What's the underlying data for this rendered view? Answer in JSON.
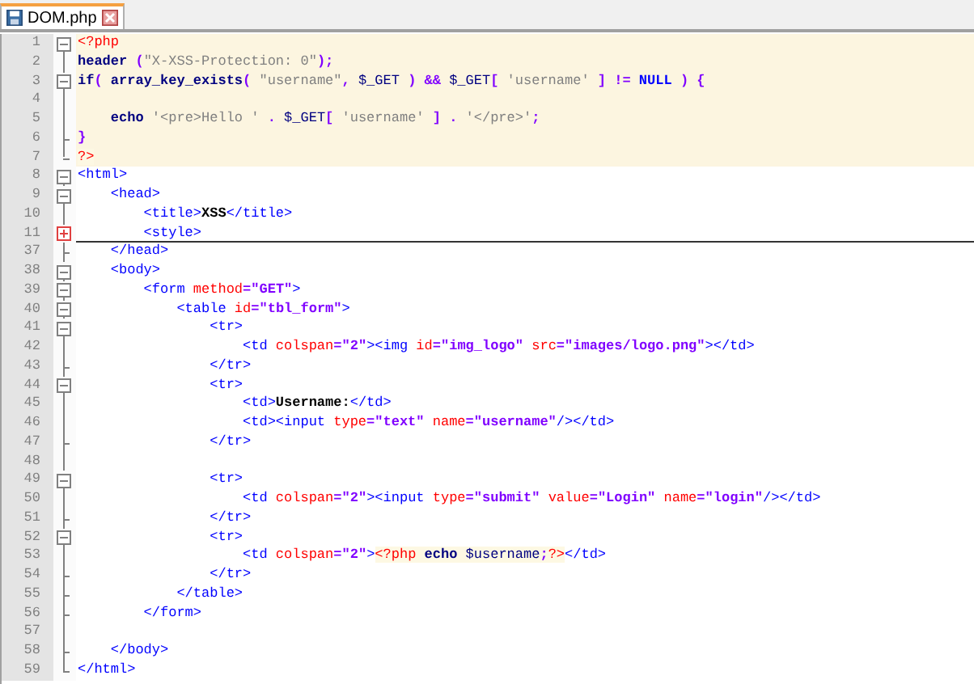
{
  "tabs": [
    {
      "label": "DOM.php",
      "selected": true
    }
  ],
  "lines": [
    {
      "number": "1",
      "kind": "fold-start",
      "php_block": true,
      "tokens": [
        {
          "kind": "php-tag",
          "text": "<?php"
        }
      ]
    },
    {
      "number": "2",
      "kind": "body",
      "php_block": true,
      "tokens": [
        {
          "kind": "fn",
          "text": "header"
        },
        {
          "kind": "op",
          "text": " ("
        },
        {
          "kind": "str",
          "text": "\"X-XSS-Protection: 0\""
        },
        {
          "kind": "op",
          "text": ");"
        }
      ]
    },
    {
      "number": "3",
      "kind": "fold-start",
      "php_block": true,
      "tokens": [
        {
          "kind": "fn",
          "text": "if"
        },
        {
          "kind": "op",
          "text": "("
        },
        {
          "kind": "fn",
          "text": " array_key_exists"
        },
        {
          "kind": "op",
          "text": "("
        },
        {
          "kind": "str",
          "text": " \"username\""
        },
        {
          "kind": "op",
          "text": ","
        },
        {
          "kind": "var",
          "text": " $_GET"
        },
        {
          "kind": "op",
          "text": " ) &&"
        },
        {
          "kind": "var",
          "text": " $_GET"
        },
        {
          "kind": "op",
          "text": "["
        },
        {
          "kind": "str",
          "text": " 'username'"
        },
        {
          "kind": "op",
          "text": " ] !="
        },
        {
          "kind": "const",
          "text": " NULL"
        },
        {
          "kind": "op",
          "text": " ) {"
        }
      ]
    },
    {
      "number": "4",
      "kind": "body",
      "php_block": true
    },
    {
      "number": "5",
      "kind": "body",
      "php_block": true,
      "tokens": [
        {
          "kind": "fn",
          "text": "    echo"
        },
        {
          "kind": "str",
          "text": " '<pre>Hello '"
        },
        {
          "kind": "op",
          "text": " ."
        },
        {
          "kind": "var",
          "text": " $_GET"
        },
        {
          "kind": "op",
          "text": "["
        },
        {
          "kind": "str",
          "text": " 'username'"
        },
        {
          "kind": "op",
          "text": " ] ."
        },
        {
          "kind": "str",
          "text": " '</pre>'"
        },
        {
          "kind": "op",
          "text": ";"
        }
      ]
    },
    {
      "number": "6",
      "kind": "fold-close",
      "php_block": true,
      "tokens": [
        {
          "kind": "op",
          "text": "}"
        }
      ]
    },
    {
      "number": "7",
      "kind": "fold-last",
      "php_block": true,
      "tokens": [
        {
          "kind": "php-tag",
          "text": "?>"
        }
      ]
    },
    {
      "number": "8",
      "kind": "fold-start",
      "php_block": false,
      "tokens": [
        {
          "kind": "tag",
          "text": "<html>"
        }
      ]
    },
    {
      "number": "9",
      "kind": "fold-start",
      "php_block": false,
      "tokens": [
        {
          "kind": "tag",
          "text": "    <head>"
        }
      ]
    },
    {
      "number": "10",
      "kind": "body",
      "php_block": false,
      "tokens": [
        {
          "kind": "tag",
          "text": "        <title>"
        },
        {
          "kind": "text",
          "text": "XSS"
        },
        {
          "kind": "tag",
          "text": "</title>"
        }
      ]
    },
    {
      "number": "11",
      "kind": "folded",
      "php_block": false,
      "tokens": [
        {
          "kind": "tag",
          "text": "        <style>"
        }
      ]
    },
    {
      "number": "37",
      "kind": "fold-close",
      "php_block": false,
      "tokens": [
        {
          "kind": "tag",
          "text": "    </head>"
        }
      ]
    },
    {
      "number": "38",
      "kind": "fold-start",
      "php_block": false,
      "tokens": [
        {
          "kind": "tag",
          "text": "    <body>"
        }
      ]
    },
    {
      "number": "39",
      "kind": "fold-start",
      "php_block": false,
      "tokens": [
        {
          "kind": "tag",
          "text": "        <form"
        },
        {
          "kind": "attr",
          "text": " method"
        },
        {
          "kind": "op",
          "text": "="
        },
        {
          "kind": "value",
          "text": "\"GET\""
        },
        {
          "kind": "tag",
          "text": ">"
        }
      ]
    },
    {
      "number": "40",
      "kind": "fold-start",
      "php_block": false,
      "tokens": [
        {
          "kind": "tag",
          "text": "            <table"
        },
        {
          "kind": "attr",
          "text": " id"
        },
        {
          "kind": "op",
          "text": "="
        },
        {
          "kind": "value",
          "text": "\"tbl_form\""
        },
        {
          "kind": "tag",
          "text": ">"
        }
      ]
    },
    {
      "number": "41",
      "kind": "fold-start",
      "php_block": false,
      "tokens": [
        {
          "kind": "tag",
          "text": "                <tr>"
        }
      ]
    },
    {
      "number": "42",
      "kind": "body",
      "php_block": false,
      "tokens": [
        {
          "kind": "tag",
          "text": "                    <td"
        },
        {
          "kind": "attr",
          "text": " colspan"
        },
        {
          "kind": "op",
          "text": "="
        },
        {
          "kind": "value",
          "text": "\"2\""
        },
        {
          "kind": "tag",
          "text": "><img"
        },
        {
          "kind": "attr",
          "text": " id"
        },
        {
          "kind": "op",
          "text": "="
        },
        {
          "kind": "value",
          "text": "\"img_logo\""
        },
        {
          "kind": "attr",
          "text": " src"
        },
        {
          "kind": "op",
          "text": "="
        },
        {
          "kind": "value",
          "text": "\"images/logo.png\""
        },
        {
          "kind": "tag",
          "text": "></td>"
        }
      ]
    },
    {
      "number": "43",
      "kind": "fold-close",
      "php_block": false,
      "tokens": [
        {
          "kind": "tag",
          "text": "                </tr>"
        }
      ]
    },
    {
      "number": "44",
      "kind": "fold-start",
      "php_block": false,
      "tokens": [
        {
          "kind": "tag",
          "text": "                <tr>"
        }
      ]
    },
    {
      "number": "45",
      "kind": "body",
      "php_block": false,
      "tokens": [
        {
          "kind": "tag",
          "text": "                    <td>"
        },
        {
          "kind": "text",
          "text": "Username:"
        },
        {
          "kind": "tag",
          "text": "</td>"
        }
      ]
    },
    {
      "number": "46",
      "kind": "body",
      "php_block": false,
      "tokens": [
        {
          "kind": "tag",
          "text": "                    <td><input"
        },
        {
          "kind": "attr",
          "text": " type"
        },
        {
          "kind": "op",
          "text": "="
        },
        {
          "kind": "value",
          "text": "\"text\""
        },
        {
          "kind": "attr",
          "text": " name"
        },
        {
          "kind": "op",
          "text": "="
        },
        {
          "kind": "value",
          "text": "\"username\""
        },
        {
          "kind": "tag",
          "text": "/></td>"
        }
      ]
    },
    {
      "number": "47",
      "kind": "fold-close",
      "php_block": false,
      "tokens": [
        {
          "kind": "tag",
          "text": "                </tr>"
        }
      ]
    },
    {
      "number": "48",
      "kind": "body",
      "php_block": false
    },
    {
      "number": "49",
      "kind": "fold-start",
      "php_block": false,
      "tokens": [
        {
          "kind": "tag",
          "text": "                <tr>"
        }
      ]
    },
    {
      "number": "50",
      "kind": "body",
      "php_block": false,
      "tokens": [
        {
          "kind": "tag",
          "text": "                    <td"
        },
        {
          "kind": "attr",
          "text": " colspan"
        },
        {
          "kind": "op",
          "text": "="
        },
        {
          "kind": "value",
          "text": "\"2\""
        },
        {
          "kind": "tag",
          "text": "><input"
        },
        {
          "kind": "attr",
          "text": " type"
        },
        {
          "kind": "op",
          "text": "="
        },
        {
          "kind": "value",
          "text": "\"submit\""
        },
        {
          "kind": "attr",
          "text": " value"
        },
        {
          "kind": "op",
          "text": "="
        },
        {
          "kind": "value",
          "text": "\"Login\""
        },
        {
          "kind": "attr",
          "text": " name"
        },
        {
          "kind": "op",
          "text": "="
        },
        {
          "kind": "value",
          "text": "\"login\""
        },
        {
          "kind": "tag",
          "text": "/></td>"
        }
      ]
    },
    {
      "number": "51",
      "kind": "fold-close",
      "php_block": false,
      "tokens": [
        {
          "kind": "tag",
          "text": "                </tr>"
        }
      ]
    },
    {
      "number": "52",
      "kind": "fold-start",
      "php_block": false,
      "tokens": [
        {
          "kind": "tag",
          "text": "                <tr>"
        }
      ]
    },
    {
      "number": "53",
      "kind": "body",
      "php_block": false,
      "tokens": [
        {
          "kind": "tag",
          "text": "                    <td"
        },
        {
          "kind": "attr",
          "text": " colspan"
        },
        {
          "kind": "op",
          "text": "="
        },
        {
          "kind": "value",
          "text": "\"2\""
        },
        {
          "kind": "tag",
          "text": ">"
        },
        {
          "kind": "php-tag",
          "text": "<?php"
        },
        {
          "kind": "php-fn",
          "text": " echo"
        },
        {
          "kind": "php-var",
          "text": " $username"
        },
        {
          "kind": "php-op",
          "text": ";"
        },
        {
          "kind": "php-tag",
          "text": "?>"
        },
        {
          "kind": "tag",
          "text": "</td>"
        }
      ]
    },
    {
      "number": "54",
      "kind": "fold-close",
      "php_block": false,
      "tokens": [
        {
          "kind": "tag",
          "text": "                </tr>"
        }
      ]
    },
    {
      "number": "55",
      "kind": "fold-close",
      "php_block": false,
      "tokens": [
        {
          "kind": "tag",
          "text": "            </table>"
        }
      ]
    },
    {
      "number": "56",
      "kind": "fold-close",
      "php_block": false,
      "tokens": [
        {
          "kind": "tag",
          "text": "        </form>"
        }
      ]
    },
    {
      "number": "57",
      "kind": "body",
      "php_block": false
    },
    {
      "number": "58",
      "kind": "fold-close",
      "php_block": false,
      "tokens": [
        {
          "kind": "tag",
          "text": "    </body>"
        }
      ]
    },
    {
      "number": "59",
      "kind": "fold-last",
      "php_block": false,
      "tokens": [
        {
          "kind": "tag",
          "text": "</html>"
        }
      ]
    }
  ]
}
